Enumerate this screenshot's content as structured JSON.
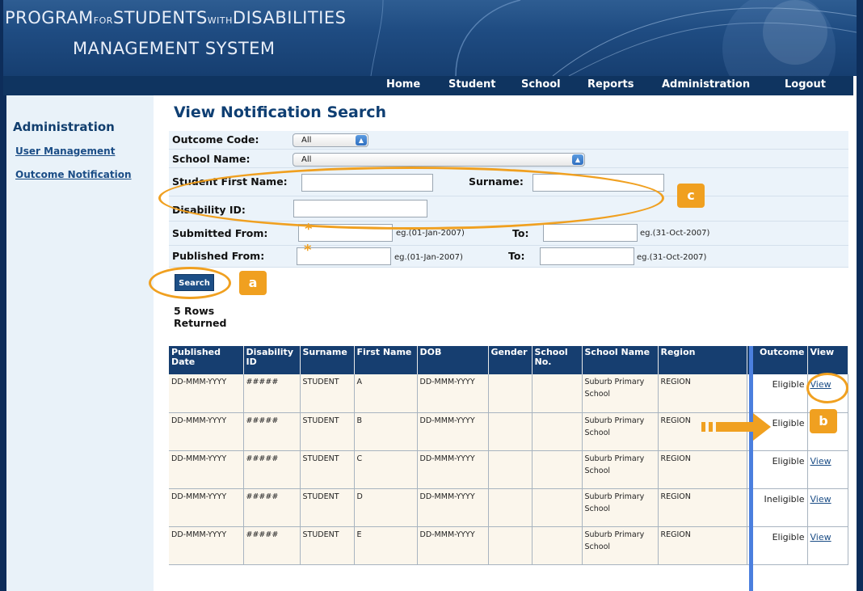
{
  "banner": {
    "line1_parts": [
      "PROGRAM",
      "FOR",
      "STUDENTS",
      "WITH",
      "DISABILITIES"
    ],
    "line2": "MANAGEMENT SYSTEM"
  },
  "nav": {
    "home": "Home",
    "student": "Student",
    "school": "School",
    "reports": "Reports",
    "administration": "Administration",
    "logout": "Logout"
  },
  "sidebar": {
    "title": "Administration",
    "links": [
      "User Management",
      "Outcome Notification"
    ]
  },
  "page": {
    "title": "View Notification Search"
  },
  "form": {
    "outcome_code": {
      "label": "Outcome Code:",
      "value": "All"
    },
    "school_name": {
      "label": "School Name:",
      "value": "All"
    },
    "first_name": {
      "label": "Student First Name:",
      "value": ""
    },
    "surname": {
      "label": "Surname:",
      "value": ""
    },
    "disability_id": {
      "label": "Disability ID:",
      "value": ""
    },
    "submitted_from": {
      "label": "Submitted From:",
      "star": "*",
      "hint": "eg.(01-Jan-2007)",
      "to_label": "To:",
      "to_hint": "eg.(31-Oct-2007)"
    },
    "published_from": {
      "label": "Published From:",
      "star": "*",
      "hint": "eg.(01-Jan-2007)",
      "to_label": "To:",
      "to_hint": "eg.(31-Oct-2007)"
    },
    "search_button": "Search"
  },
  "results": {
    "count_text": "5 Rows Returned",
    "headers": [
      "Published Date",
      "Disability ID",
      "Surname",
      "First Name",
      "DOB",
      "Gender",
      "School No.",
      "School Name",
      "Region",
      "Outcome",
      "View"
    ],
    "rows": [
      {
        "published": "DD-MMM-YYYY",
        "disability_id": "#####",
        "surname": "STUDENT",
        "first": "A",
        "dob": "DD-MMM-YYYY",
        "gender": "",
        "school_no": "",
        "school_name": "Suburb Primary School",
        "region": "REGION",
        "outcome": "Eligible",
        "view": "View"
      },
      {
        "published": "DD-MMM-YYYY",
        "disability_id": "#####",
        "surname": "STUDENT",
        "first": "B",
        "dob": "DD-MMM-YYYY",
        "gender": "",
        "school_no": "",
        "school_name": "Suburb Primary School",
        "region": "REGION",
        "outcome": "Eligible",
        "view": ""
      },
      {
        "published": "DD-MMM-YYYY",
        "disability_id": "#####",
        "surname": "STUDENT",
        "first": "C",
        "dob": "DD-MMM-YYYY",
        "gender": "",
        "school_no": "",
        "school_name": "Suburb Primary School",
        "region": "REGION",
        "outcome": "Eligible",
        "view": "View"
      },
      {
        "published": "DD-MMM-YYYY",
        "disability_id": "#####",
        "surname": "STUDENT",
        "first": "D",
        "dob": "DD-MMM-YYYY",
        "gender": "",
        "school_no": "",
        "school_name": "Suburb Primary School",
        "region": "REGION",
        "outcome": "Ineligible",
        "view": "View"
      },
      {
        "published": "DD-MMM-YYYY",
        "disability_id": "#####",
        "surname": "STUDENT",
        "first": "E",
        "dob": "DD-MMM-YYYY",
        "gender": "",
        "school_no": "",
        "school_name": "Suburb Primary School",
        "region": "REGION",
        "outcome": "Eligible",
        "view": "View"
      }
    ]
  },
  "callouts": {
    "a": "a",
    "b": "b",
    "c": "c"
  },
  "colors": {
    "accent": "#f0a020",
    "header_blue": "#163e70",
    "banner_blue": "#1f4c82"
  }
}
